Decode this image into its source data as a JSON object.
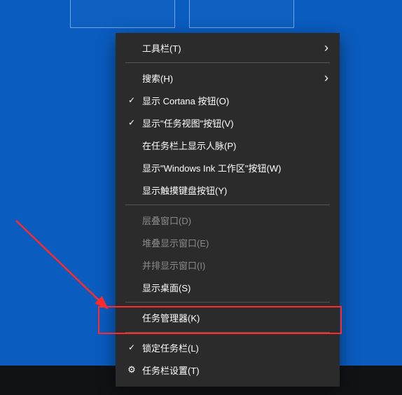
{
  "menu": {
    "toolbar": {
      "label": "工具栏(T)",
      "has_submenu": true
    },
    "search": {
      "label": "搜索(H)",
      "has_submenu": true
    },
    "showCortana": {
      "label": "显示 Cortana 按钮(O)"
    },
    "showTaskView": {
      "label": "显示\"任务视图\"按钮(V)"
    },
    "showPeople": {
      "label": "在任务栏上显示人脉(P)"
    },
    "showInk": {
      "label": "显示\"Windows Ink 工作区\"按钮(W)"
    },
    "showTouchKb": {
      "label": "显示触摸键盘按钮(Y)"
    },
    "cascadeWin": {
      "label": "层叠窗口(D)"
    },
    "stackWin": {
      "label": "堆叠显示窗口(E)"
    },
    "sideBySide": {
      "label": "并排显示窗口(I)"
    },
    "showDesktop": {
      "label": "显示桌面(S)"
    },
    "taskManager": {
      "label": "任务管理器(K)"
    },
    "lockTaskbar": {
      "label": "锁定任务栏(L)"
    },
    "taskbarSet": {
      "label": "任务栏设置(T)"
    }
  },
  "annotation": {
    "highlight_target": "taskManager",
    "arrow_color": "#ff2a2a"
  }
}
